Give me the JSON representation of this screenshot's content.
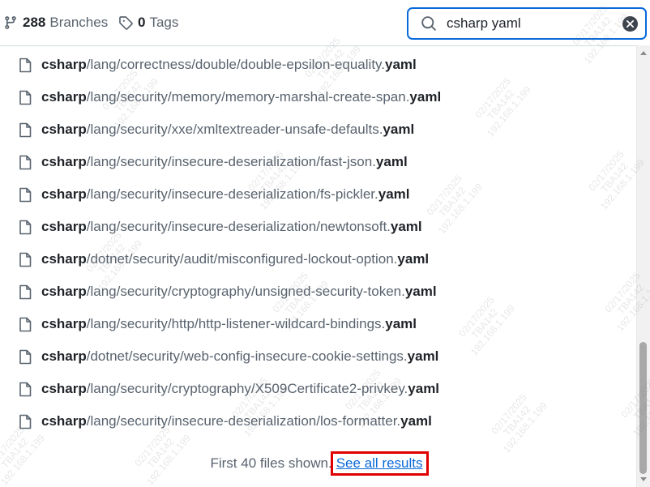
{
  "header": {
    "branches_count": "288",
    "branches_label": "Branches",
    "tags_count": "0",
    "tags_label": "Tags"
  },
  "search": {
    "value": "csharp yaml",
    "icons": {
      "search": "search-icon",
      "clear": "clear-icon"
    }
  },
  "files": [
    {
      "bold": "csharp",
      "path": "/lang/correctness/double/double-epsilon-equality.",
      "ext": "yaml"
    },
    {
      "bold": "csharp",
      "path": "/lang/security/memory/memory-marshal-create-span.",
      "ext": "yaml"
    },
    {
      "bold": "csharp",
      "path": "/lang/security/xxe/xmltextreader-unsafe-defaults.",
      "ext": "yaml"
    },
    {
      "bold": "csharp",
      "path": "/lang/security/insecure-deserialization/fast-json.",
      "ext": "yaml"
    },
    {
      "bold": "csharp",
      "path": "/lang/security/insecure-deserialization/fs-pickler.",
      "ext": "yaml"
    },
    {
      "bold": "csharp",
      "path": "/lang/security/insecure-deserialization/newtonsoft.",
      "ext": "yaml"
    },
    {
      "bold": "csharp",
      "path": "/dotnet/security/audit/misconfigured-lockout-option.",
      "ext": "yaml"
    },
    {
      "bold": "csharp",
      "path": "/lang/security/cryptography/unsigned-security-token.",
      "ext": "yaml"
    },
    {
      "bold": "csharp",
      "path": "/lang/security/http/http-listener-wildcard-bindings.",
      "ext": "yaml"
    },
    {
      "bold": "csharp",
      "path": "/dotnet/security/web-config-insecure-cookie-settings.",
      "ext": "yaml"
    },
    {
      "bold": "csharp",
      "path": "/lang/security/cryptography/X509Certificate2-privkey.",
      "ext": "yaml"
    },
    {
      "bold": "csharp",
      "path": "/lang/security/insecure-deserialization/los-formatter.",
      "ext": "yaml"
    }
  ],
  "footer": {
    "text": "First 40 files shown.",
    "link": "See all results"
  },
  "watermark": {
    "date": "02/17/2025",
    "user": "TBA142",
    "ip": "192.168.1.199"
  },
  "colors": {
    "accent": "#0969da",
    "highlight_box": "#e00000",
    "text_primary": "#1f2328",
    "text_muted": "#59636e"
  }
}
